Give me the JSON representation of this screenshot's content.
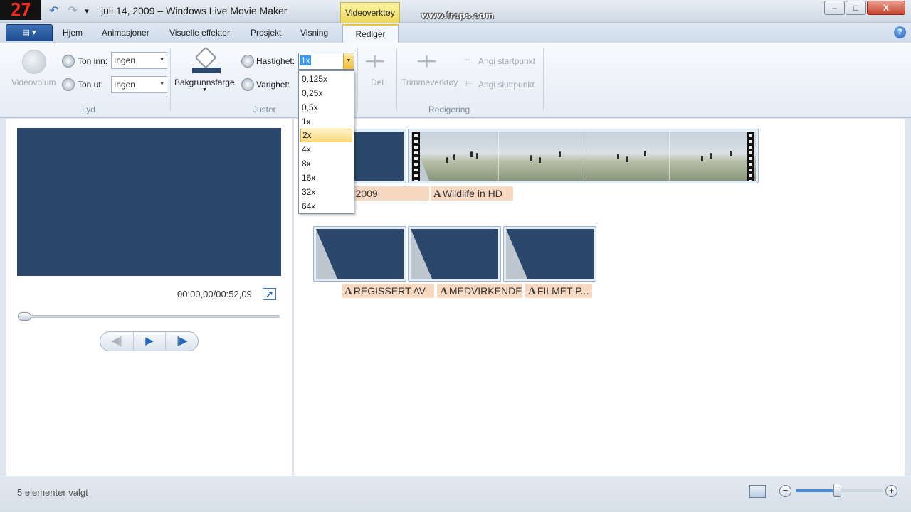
{
  "titlebar": {
    "fps_counter": "27",
    "title": "juli 14, 2009 – Windows Live Movie Maker",
    "contextual_tab": "Videoverktøy",
    "watermark": "www.fraps.com",
    "minimize_glyph": "–",
    "maximize_glyph": "□",
    "close_glyph": "X",
    "undo_glyph": "↶",
    "redo_glyph": "↷",
    "customize_glyph": "▾"
  },
  "ribbon_tabs": {
    "app_menu_glyph": "▤ ▾",
    "items": [
      "Hjem",
      "Animasjoner",
      "Visuelle effekter",
      "Prosjekt",
      "Visning"
    ],
    "active": "Rediger",
    "help_glyph": "?"
  },
  "ribbon": {
    "lyd": {
      "group_label": "Lyd",
      "videovolum": "Videovolum",
      "ton_inn_label": "Ton inn:",
      "ton_inn_value": "Ingen",
      "ton_ut_label": "Ton ut:",
      "ton_ut_value": "Ingen"
    },
    "juster": {
      "group_label": "Juster",
      "bakgrunnsfarge": "Bakgrunnsfarge",
      "hastighet_label": "Hastighet:",
      "hastighet_value": "1x",
      "varighet_label": "Varighet:",
      "speed_options": [
        "0,125x",
        "0,25x",
        "0,5x",
        "1x",
        "2x",
        "4x",
        "8x",
        "16x",
        "32x",
        "64x"
      ],
      "highlighted_option": "2x"
    },
    "redigering": {
      "group_label": "Redigering",
      "del": "Del",
      "trimmeverktoy": "Trimmeverktøy",
      "angi_startpunkt": "Angi startpunkt",
      "angi_sluttpunkt": "Angi sluttpunkt"
    }
  },
  "preview": {
    "timecode": "00:00,00/00:52,09",
    "expand_glyph": "↗",
    "prev_glyph": "◀|",
    "play_glyph": "▶",
    "next_glyph": "|▶",
    "seek_position": 0
  },
  "storyboard": {
    "row1_captions": [
      "4, 2009",
      "Wildlife in HD"
    ],
    "row2_captions": [
      "REGISSERT AV",
      "MEDVIRKENDE",
      "FILMET P..."
    ],
    "caption_glyph": "A"
  },
  "statusbar": {
    "status_text": "5 elementer valgt",
    "zoom_out_glyph": "−",
    "zoom_in_glyph": "+",
    "zoom_level": 0.47
  },
  "colors": {
    "title_card": "#2b476b",
    "caption_bg": "#f7d8c1",
    "accent": "#1f66c1"
  }
}
